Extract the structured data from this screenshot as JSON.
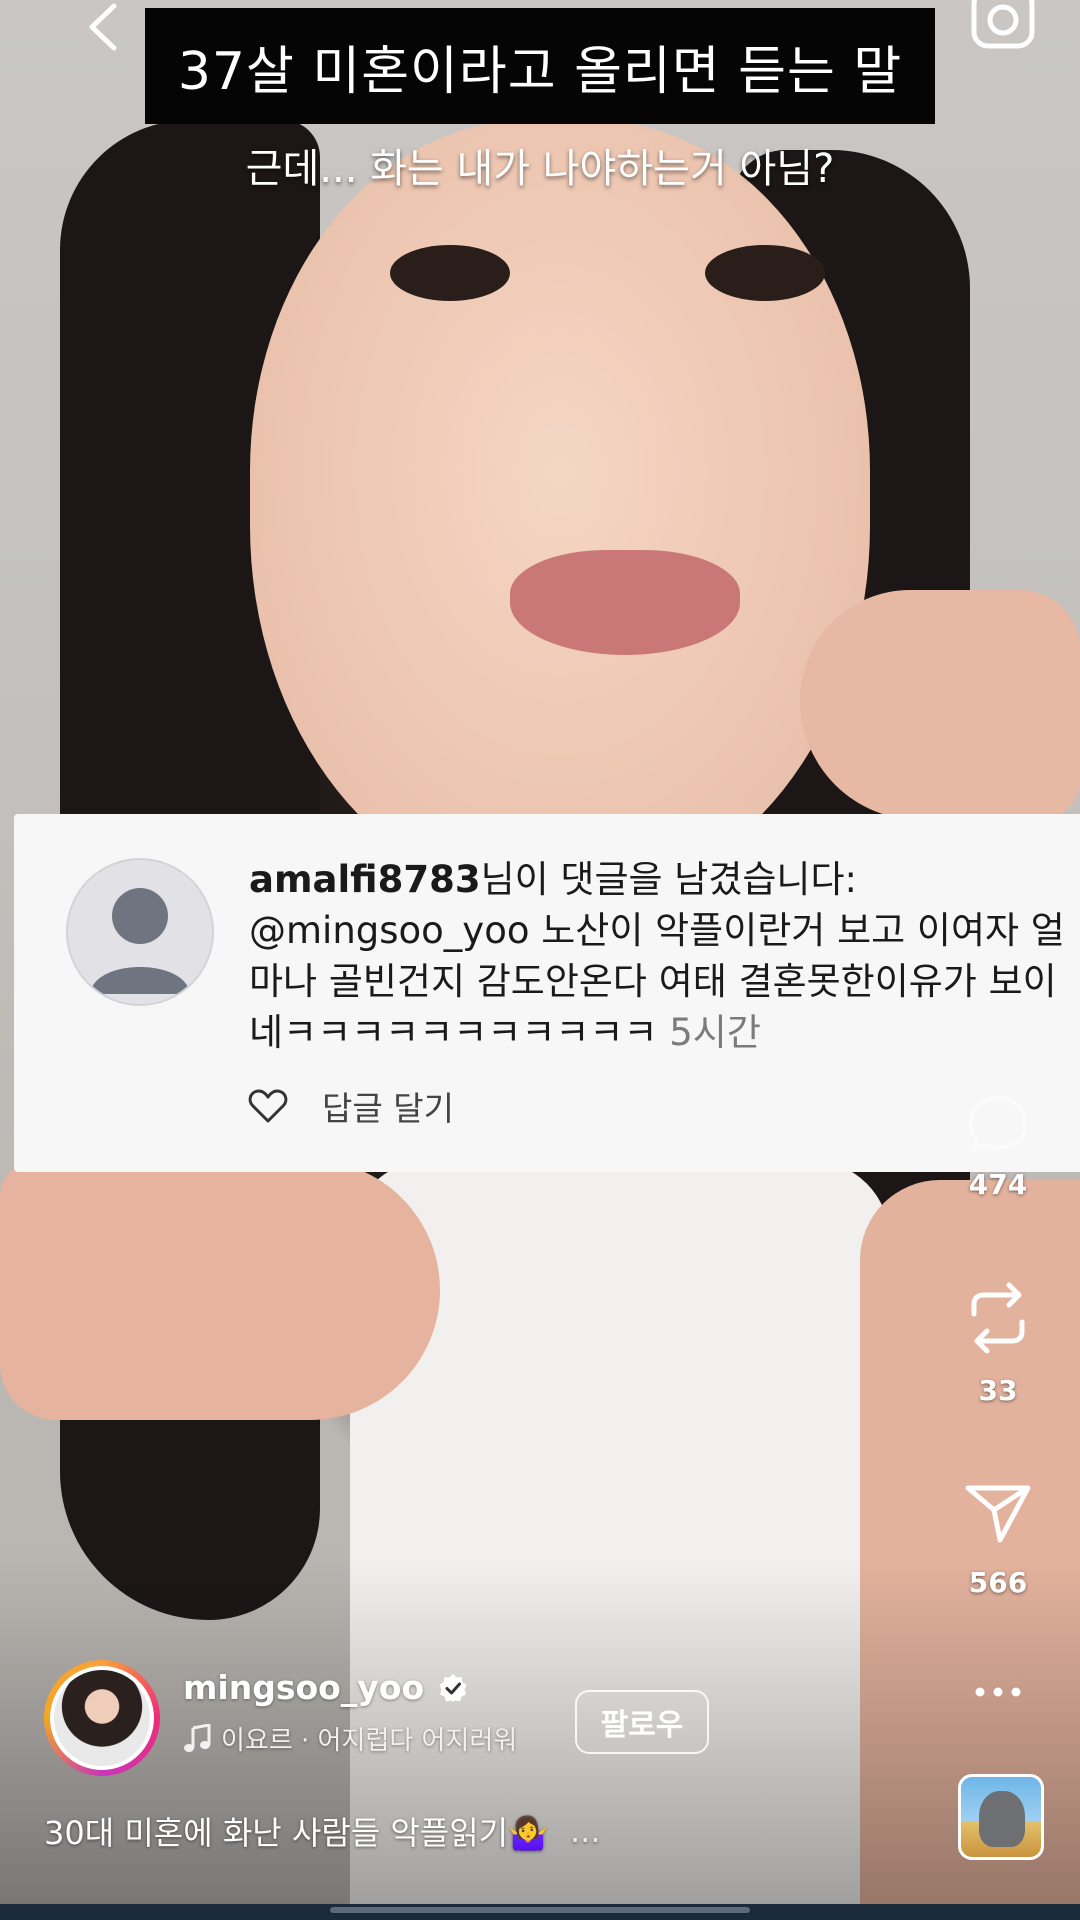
{
  "video": {
    "title_banner": "37살 미혼이라고 올리면 듣는 말",
    "subtitle": "근데... 화는 내가 나야하는거 아님?"
  },
  "comment": {
    "username": "amalfi8783",
    "notice": "님이 댓글을 남겼습니다:",
    "text": "@mingsoo_yoo 노산이 악플이란거 보고 이여자 얼마나 골빈건지 감도안온다 여태 결혼못한이유가 보이네ㅋㅋㅋㅋㅋㅋㅋㅋㅋㅋㅋ",
    "time": "5시간",
    "reply_label": "답글 달기"
  },
  "actions": {
    "comments_count": "474",
    "reposts_count": "33",
    "shares_count": "566"
  },
  "author": {
    "username": "mingsoo_yoo",
    "follow_label": "팔로우",
    "music": "이요르 · 어지럽다 어지러워"
  },
  "caption": {
    "text": "30대 미혼에 화난 사람들 악플읽기🤷‍♀️",
    "more": "..."
  },
  "icons": {
    "back": "chevron-left-icon",
    "camera": "camera-icon",
    "heart": "heart-icon",
    "comment": "comment-icon",
    "repost": "repost-icon",
    "share": "send-icon",
    "more": "more-icon",
    "music": "music-note-icon",
    "verified": "verified-badge-icon"
  }
}
